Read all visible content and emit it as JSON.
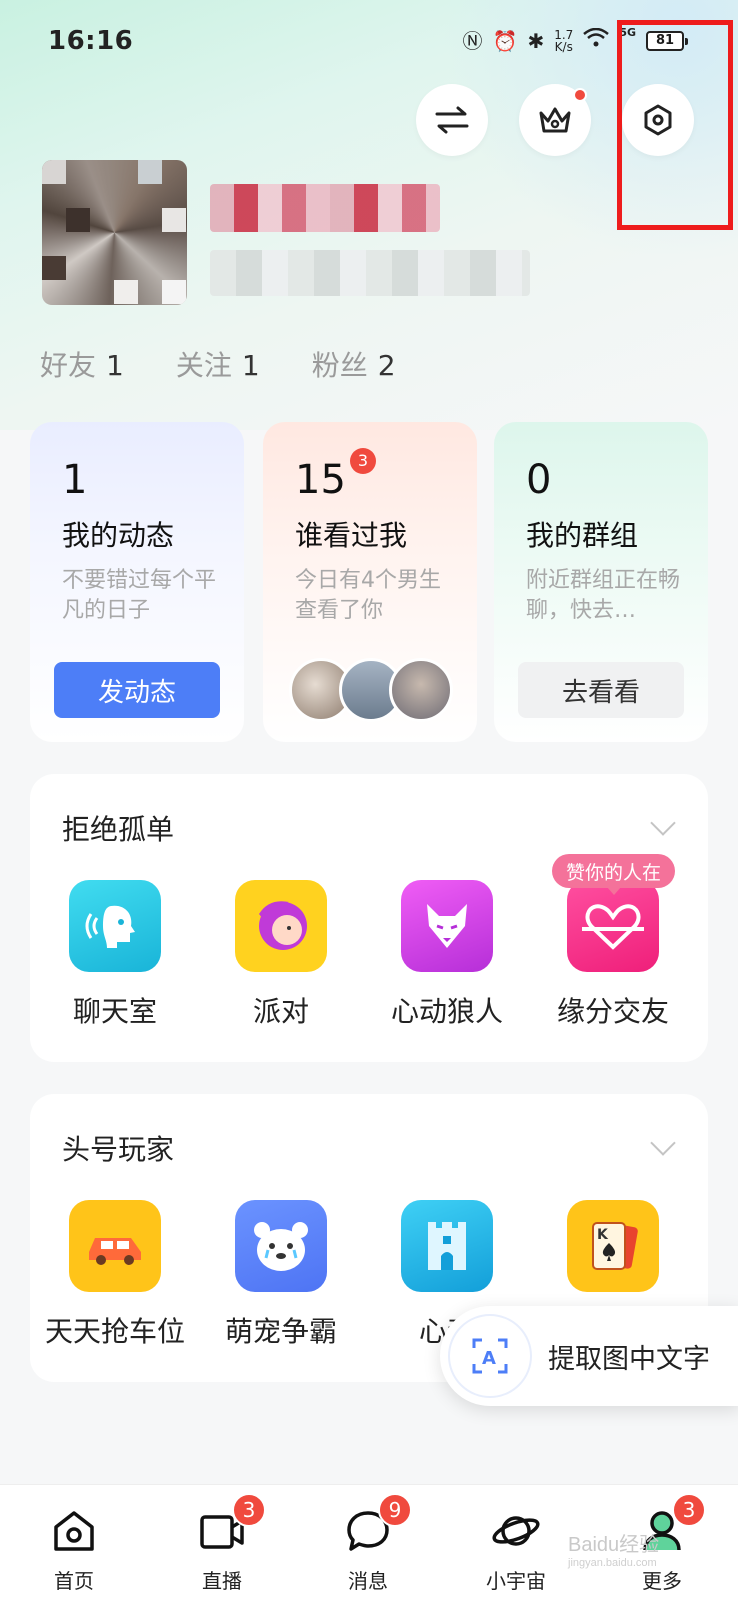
{
  "status_bar": {
    "time": "16:16",
    "speed_value": "1.7",
    "speed_unit": "K/s",
    "network": "5G",
    "battery": "81"
  },
  "header_buttons": {
    "switch_icon": "swap-arrows-icon",
    "vip_icon": "crown-icon",
    "settings_icon": "hexagon-settings-icon"
  },
  "profile": {
    "stats": [
      {
        "label": "好友",
        "value": "1"
      },
      {
        "label": "关注",
        "value": "1"
      },
      {
        "label": "粉丝",
        "value": "2"
      }
    ]
  },
  "cards": [
    {
      "count": "1",
      "title": "我的动态",
      "desc": "不要错过每个平凡的日子",
      "button": "发动态"
    },
    {
      "count": "15",
      "badge": "3",
      "title": "谁看过我",
      "desc": "今日有4个男生查看了你"
    },
    {
      "count": "0",
      "title": "我的群组",
      "desc": "附近群组正在畅聊，快去…",
      "button": "去看看"
    }
  ],
  "section_social": {
    "title": "拒绝孤单",
    "pill": "赞你的人在",
    "apps": [
      {
        "label": "聊天室",
        "icon": "voice-chat-icon",
        "color": "#22c7e3"
      },
      {
        "label": "派对",
        "icon": "party-face-icon",
        "color": "#ffd21f"
      },
      {
        "label": "心动狼人",
        "icon": "wolf-icon",
        "color": "#d43ee6"
      },
      {
        "label": "缘分交友",
        "icon": "heart-knot-icon",
        "color": "#ff2f8a"
      }
    ]
  },
  "section_games": {
    "title": "头号玩家",
    "apps": [
      {
        "label": "天天抢车位",
        "icon": "car-icon",
        "color": "#ffc419"
      },
      {
        "label": "萌宠争霸",
        "icon": "bear-icon",
        "color": "#5f86ff"
      },
      {
        "label": "心动",
        "icon": "castle-icon",
        "color": "#1fb8ea"
      },
      {
        "label": "",
        "icon": "poker-card-icon",
        "color": "#ffc419"
      }
    ]
  },
  "ocr_float": {
    "label": "提取图中文字",
    "icon": "text-scan-icon"
  },
  "bottom_nav": [
    {
      "label": "首页",
      "icon": "home-icon"
    },
    {
      "label": "直播",
      "icon": "live-video-icon",
      "badge": "3"
    },
    {
      "label": "消息",
      "icon": "message-bubble-icon",
      "badge": "9"
    },
    {
      "label": "小宇宙",
      "icon": "planet-icon"
    },
    {
      "label": "更多",
      "icon": "more-person-icon",
      "badge": "3"
    }
  ],
  "watermark": {
    "main": "Baidu经验",
    "sub": "jingyan.baidu.com"
  }
}
